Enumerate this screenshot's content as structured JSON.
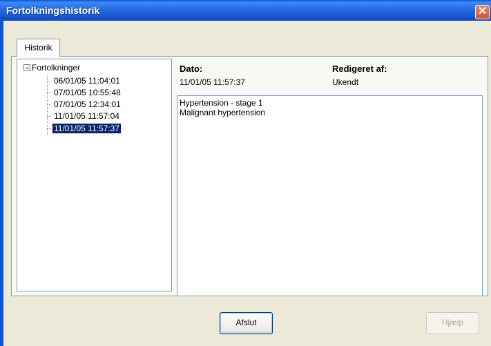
{
  "window": {
    "title": "Fortolkningshistorik",
    "close_glyph": "✕"
  },
  "tabs": [
    {
      "label": "Historik"
    }
  ],
  "tree": {
    "root_label": "Fortolkninger",
    "items": [
      {
        "label": "06/01/05 11:04:01"
      },
      {
        "label": "07/01/05 10:55:48"
      },
      {
        "label": "07/01/05 12:34:01"
      },
      {
        "label": "11/01/05 11:57:04"
      },
      {
        "label": "11/01/05 11:57:37",
        "selected": true
      }
    ]
  },
  "details": {
    "date_label": "Dato:",
    "date_value": "11/01/05 11:57:37",
    "editor_label": "Redigeret af:",
    "editor_value": "Ukendt",
    "lines": [
      "Hypertension - stage 1",
      "Malignant hypertension"
    ]
  },
  "buttons": {
    "close_label": "Afslut",
    "help_label": "Hjælp"
  },
  "colors": {
    "titlebar": "#1a5fd8",
    "selection": "#0a246a",
    "dialog_bg": "#ece9d8"
  }
}
